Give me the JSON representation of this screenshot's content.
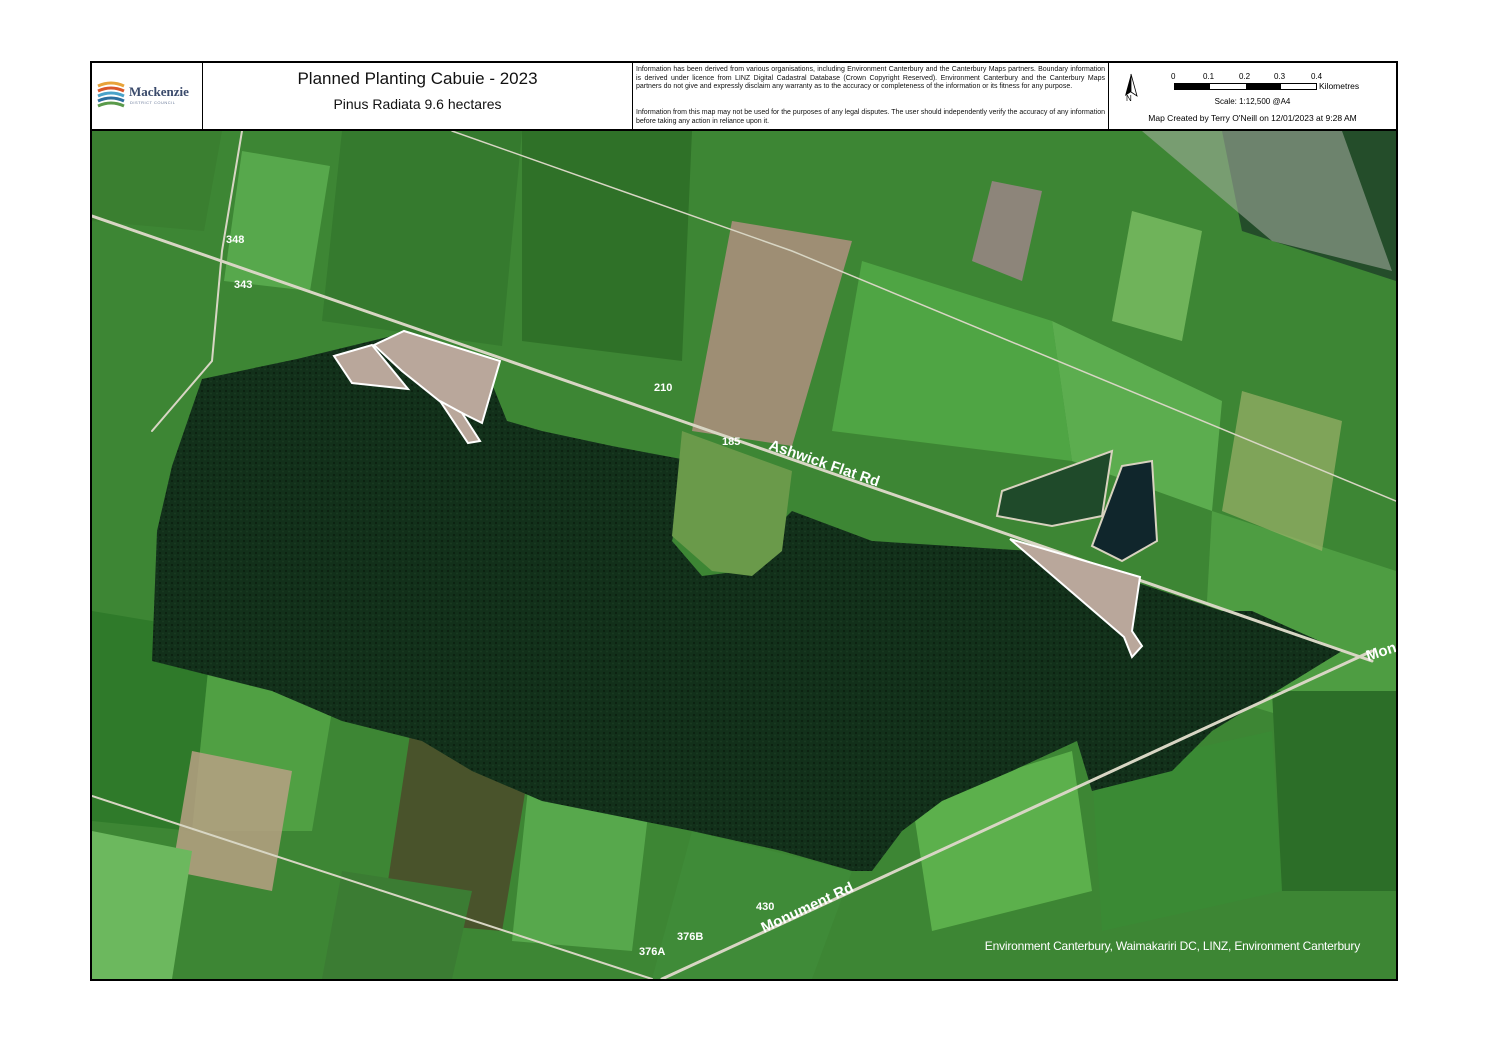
{
  "logo": {
    "name": "Mackenzie",
    "subtitle": "DISTRICT COUNCIL"
  },
  "header": {
    "title": "Planned Planting Cabuie - 2023",
    "subtitle": "Pinus Radiata 9.6 hectares"
  },
  "disclaimer": {
    "paragraph1": "Information has been derived from various organisations, including Environment Canterbury and the Canterbury Maps partners. Boundary information is derived under licence from LINZ Digital Cadastral Database (Crown Copyright Reserved). Environment Canterbury and the Canterbury Maps partners do not give and expressly disclaim any warranty as to the accuracy or completeness of the information or its fitness for any purpose.",
    "paragraph2": "Information from this map may not be used for the purposes of any legal disputes. The user should independently verify the accuracy of any information before taking any action in reliance upon it."
  },
  "map_meta": {
    "north_label": "N",
    "scale_ticks": [
      "0",
      "0.1",
      "0.2",
      "0.3",
      "0.4"
    ],
    "scale_unit": "Kilometres",
    "scale_text": "Scale: 1:12,500 @A4",
    "created_by": "Map Created by Terry O'Neill on 12/01/2023 at 9:28 AM"
  },
  "map_labels": {
    "road_ashwick": "Ashwick Flat Rd",
    "road_monument": "Monument Rd",
    "road_mon_edge": "Mon",
    "addr_348": "348",
    "addr_343": "343",
    "addr_210": "210",
    "addr_185": "185",
    "addr_430": "430",
    "addr_376b": "376B",
    "addr_376a": "376A"
  },
  "attribution": "Environment Canterbury, Waimakariri DC, LINZ, Environment Canterbury",
  "colors": {
    "forest": "#0f2a14",
    "pasture": "#3f8a35",
    "planting_fill": "#b9a79b",
    "planting_stroke": "#ffffff",
    "road": "#d8d6c4"
  }
}
